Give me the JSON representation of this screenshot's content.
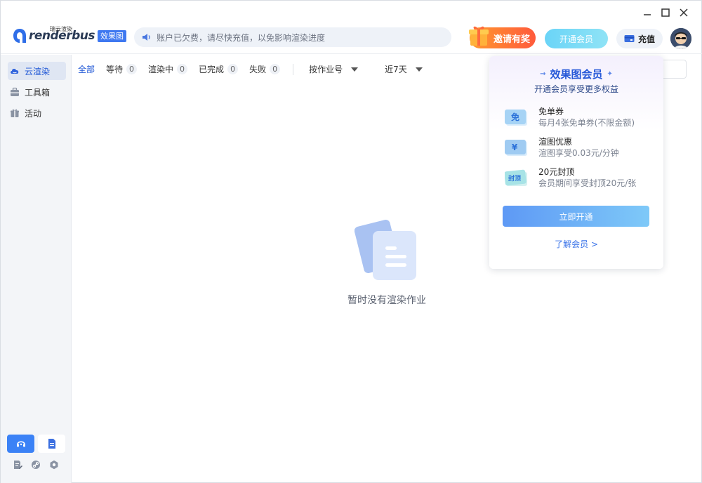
{
  "app": {
    "logo_small_text": "瑞云渲染",
    "logo_text": "renderbus",
    "logo_badge": "效果图"
  },
  "header": {
    "notice": "账户已欠费，请尽快充值，以免影响渲染进度",
    "invite_label": "邀请有奖",
    "vip_label": "开通会员",
    "recharge_label": "充值"
  },
  "sidebar": {
    "items": [
      {
        "label": "云渲染",
        "icon": "cloud-icon",
        "active": true
      },
      {
        "label": "工具箱",
        "icon": "toolbox-icon",
        "active": false
      },
      {
        "label": "活动",
        "icon": "gift-icon",
        "active": false
      }
    ]
  },
  "filters": {
    "all": "全部",
    "waiting": "等待",
    "waiting_count": "0",
    "rendering": "渲染中",
    "rendering_count": "0",
    "done": "已完成",
    "done_count": "0",
    "failed": "失败",
    "failed_count": "0",
    "sort_by": "按作业号",
    "time_range": "近7天"
  },
  "empty_state": {
    "text": "暂时没有渲染作业"
  },
  "popover": {
    "title": "效果图会员",
    "subtitle": "开通会员享受更多权益",
    "benefits": [
      {
        "title": "免单券",
        "desc": "每月4张免单券(不限金额)",
        "icon_text": "免"
      },
      {
        "title": "渲图优惠",
        "desc": "渲图享受0.03元/分钟",
        "icon_text": "¥"
      },
      {
        "title": "20元封顶",
        "desc": "会员期间享受封顶20元/张",
        "icon_text": "封顶"
      }
    ],
    "cta": "立即开通",
    "link": "了解会员 >"
  },
  "colors": {
    "accent": "#1f57d6",
    "brand_badge": "#3e78f0",
    "invite": "#ff6a3a",
    "vip": "#6ad4f7"
  }
}
